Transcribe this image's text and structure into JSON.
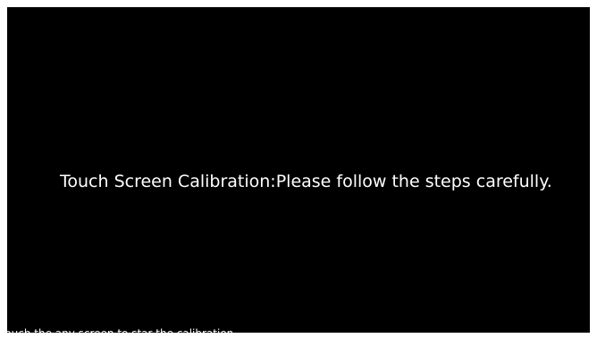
{
  "calibration": {
    "title": "Touch Screen Calibration:Please follow the steps carefully.",
    "instruction": "Touch the any screen to star the calibration."
  },
  "colors": {
    "screen_background": "#000000",
    "text": "#ffffff",
    "page_background": "#ffffff"
  }
}
